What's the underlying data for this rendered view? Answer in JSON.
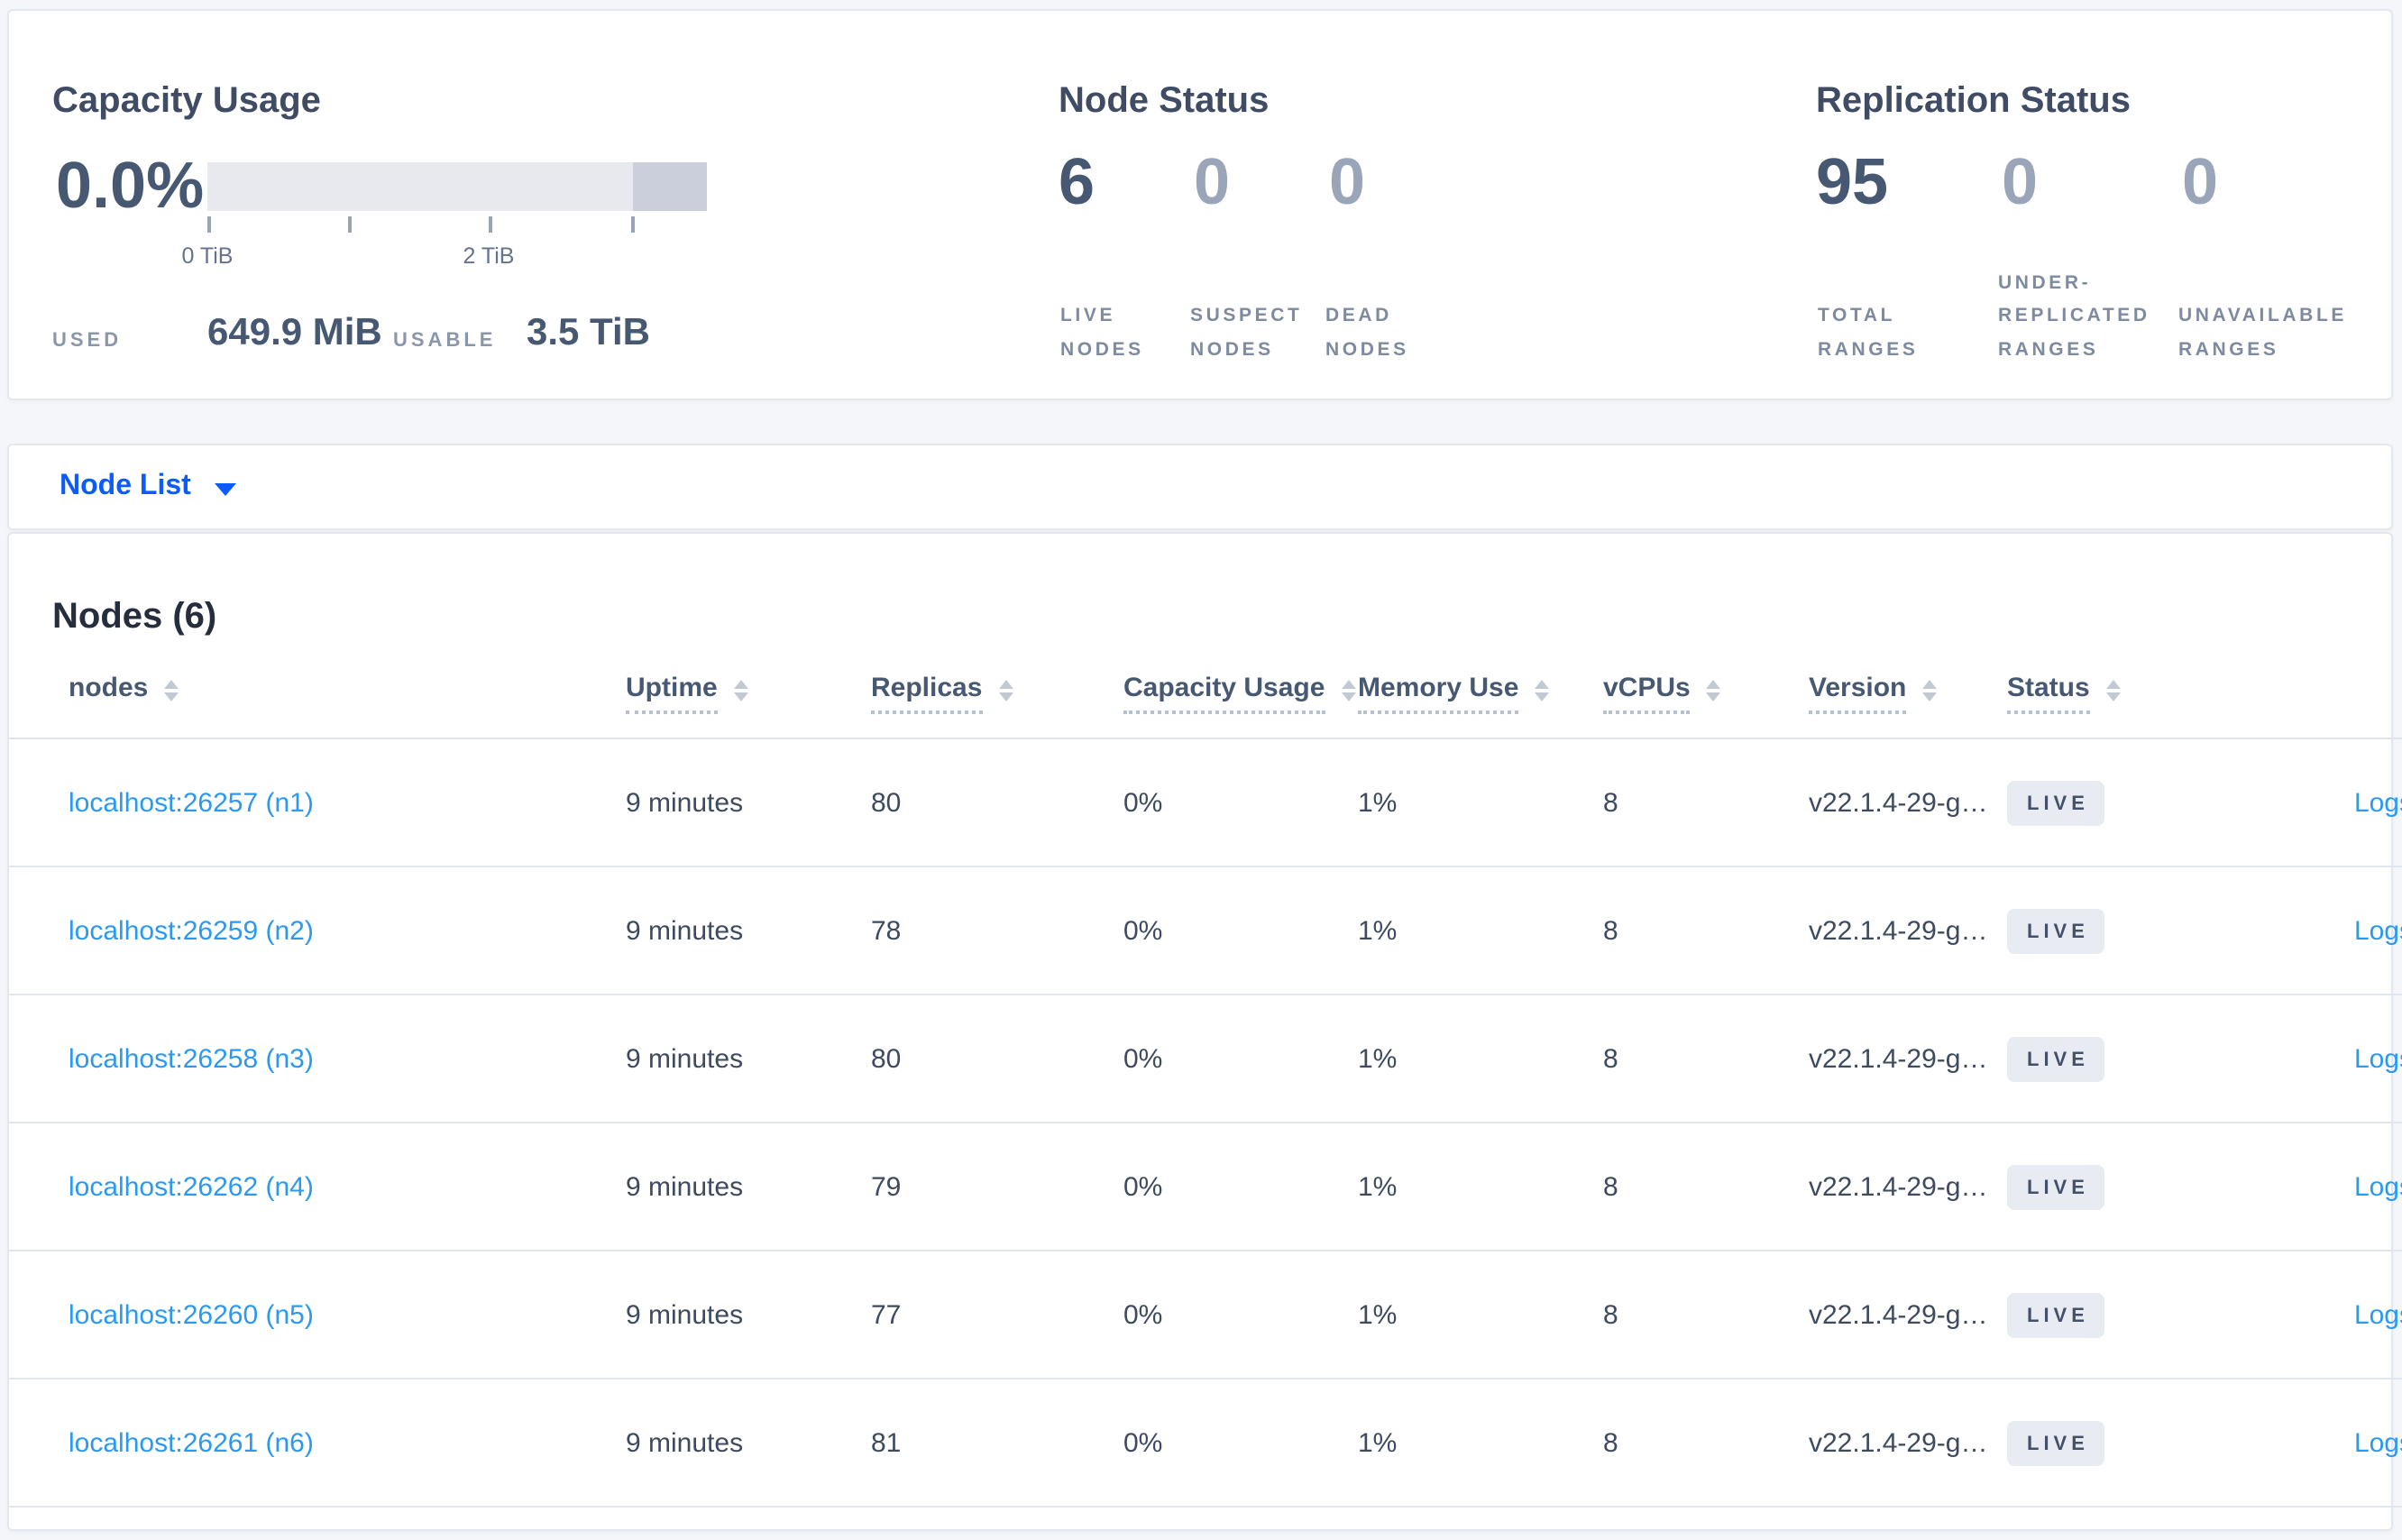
{
  "colors": {
    "page_bg": "#f4f6f9",
    "accent_link_blue": "#0b5bff",
    "table_link_blue": "#2b99f0",
    "heading_slate": "#475872",
    "muted_number": "#9aa5ba",
    "badge_bg": "#e8ecf2",
    "badge_text": "#44506b",
    "capacity_bar_light": "#e7e9ef",
    "capacity_bar_dark": "#cacfdb"
  },
  "summary": {
    "capacity": {
      "title": "Capacity Usage",
      "percent": "0.0%",
      "tick_labels": [
        "0 TiB",
        "2 TiB"
      ],
      "used_label": "USED",
      "used_value": "649.9 MiB",
      "usable_label": "USABLE",
      "usable_value": "3.5 TiB"
    },
    "node_status": {
      "title": "Node Status",
      "stats": [
        {
          "value": "6",
          "label": "LIVE NODES"
        },
        {
          "value": "0",
          "label": "SUSPECT NODES"
        },
        {
          "value": "0",
          "label": "DEAD NODES"
        }
      ]
    },
    "replication_status": {
      "title": "Replication Status",
      "stats": [
        {
          "value": "95",
          "label": "TOTAL RANGES"
        },
        {
          "value": "0",
          "label": "UNDER-REPLICATED RANGES"
        },
        {
          "value": "0",
          "label": "UNAVAILABLE RANGES"
        }
      ]
    }
  },
  "view_selector": {
    "label": "Node List"
  },
  "table": {
    "title": "Nodes (6)",
    "columns": [
      {
        "label": "nodes",
        "sortable": true,
        "underline": false
      },
      {
        "label": "Uptime",
        "sortable": true,
        "underline": true
      },
      {
        "label": "Replicas",
        "sortable": true,
        "underline": true
      },
      {
        "label": "Capacity Usage",
        "sortable": true,
        "underline": true
      },
      {
        "label": "Memory Use",
        "sortable": true,
        "underline": true
      },
      {
        "label": "vCPUs",
        "sortable": true,
        "underline": true
      },
      {
        "label": "Version",
        "sortable": true,
        "underline": true
      },
      {
        "label": "Status",
        "sortable": true,
        "underline": true
      },
      {
        "label": "",
        "sortable": false,
        "underline": false
      }
    ],
    "rows": [
      {
        "node": "localhost:26257 (n1)",
        "uptime": "9 minutes",
        "replicas": "80",
        "capacity": "0%",
        "memory": "1%",
        "vcpus": "8",
        "version": "v22.1.4-29-g…",
        "status": "LIVE",
        "logs": "Logs"
      },
      {
        "node": "localhost:26259 (n2)",
        "uptime": "9 minutes",
        "replicas": "78",
        "capacity": "0%",
        "memory": "1%",
        "vcpus": "8",
        "version": "v22.1.4-29-g…",
        "status": "LIVE",
        "logs": "Logs"
      },
      {
        "node": "localhost:26258 (n3)",
        "uptime": "9 minutes",
        "replicas": "80",
        "capacity": "0%",
        "memory": "1%",
        "vcpus": "8",
        "version": "v22.1.4-29-g…",
        "status": "LIVE",
        "logs": "Logs"
      },
      {
        "node": "localhost:26262 (n4)",
        "uptime": "9 minutes",
        "replicas": "79",
        "capacity": "0%",
        "memory": "1%",
        "vcpus": "8",
        "version": "v22.1.4-29-g…",
        "status": "LIVE",
        "logs": "Logs"
      },
      {
        "node": "localhost:26260 (n5)",
        "uptime": "9 minutes",
        "replicas": "77",
        "capacity": "0%",
        "memory": "1%",
        "vcpus": "8",
        "version": "v22.1.4-29-g…",
        "status": "LIVE",
        "logs": "Logs"
      },
      {
        "node": "localhost:26261 (n6)",
        "uptime": "9 minutes",
        "replicas": "81",
        "capacity": "0%",
        "memory": "1%",
        "vcpus": "8",
        "version": "v22.1.4-29-g…",
        "status": "LIVE",
        "logs": "Logs"
      }
    ]
  }
}
